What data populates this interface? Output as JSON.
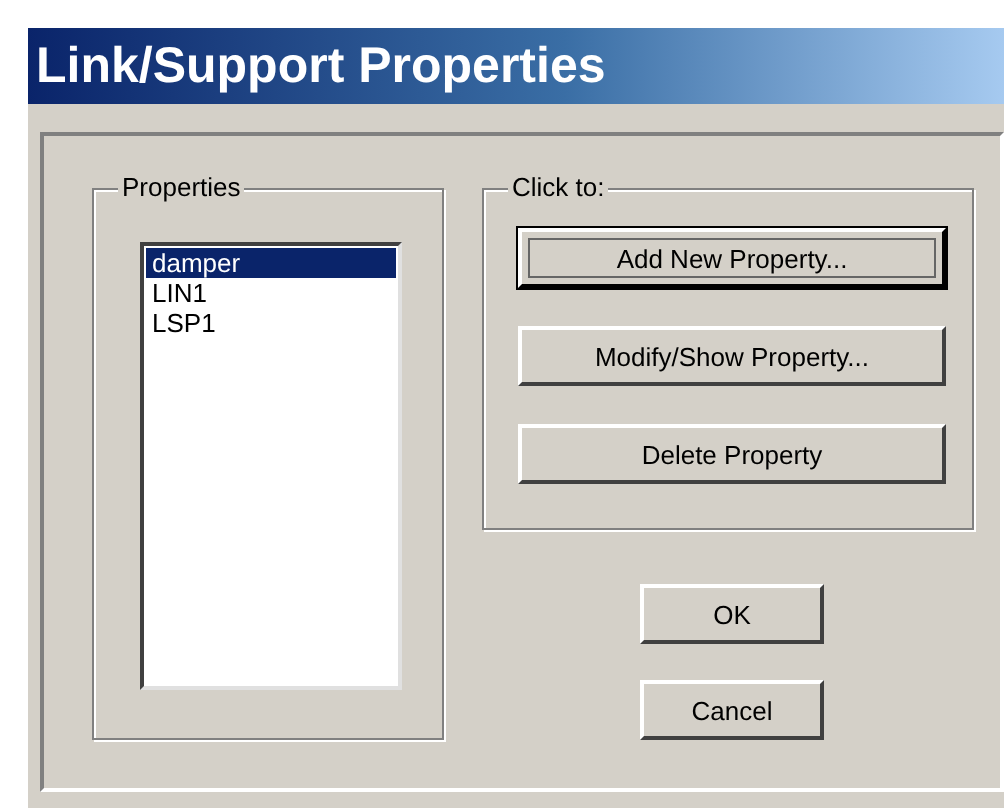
{
  "window": {
    "title": "Link/Support Properties"
  },
  "properties_group": {
    "label": "Properties",
    "items": [
      {
        "label": "damper",
        "selected": true
      },
      {
        "label": "LIN1",
        "selected": false
      },
      {
        "label": "LSP1",
        "selected": false
      }
    ]
  },
  "click_to_group": {
    "label": "Click to:",
    "buttons": [
      {
        "label": "Add New Property...",
        "focused": true
      },
      {
        "label": "Modify/Show Property...",
        "focused": false
      },
      {
        "label": "Delete Property",
        "focused": false
      }
    ]
  },
  "buttons": [
    "OK",
    "Cancel"
  ]
}
